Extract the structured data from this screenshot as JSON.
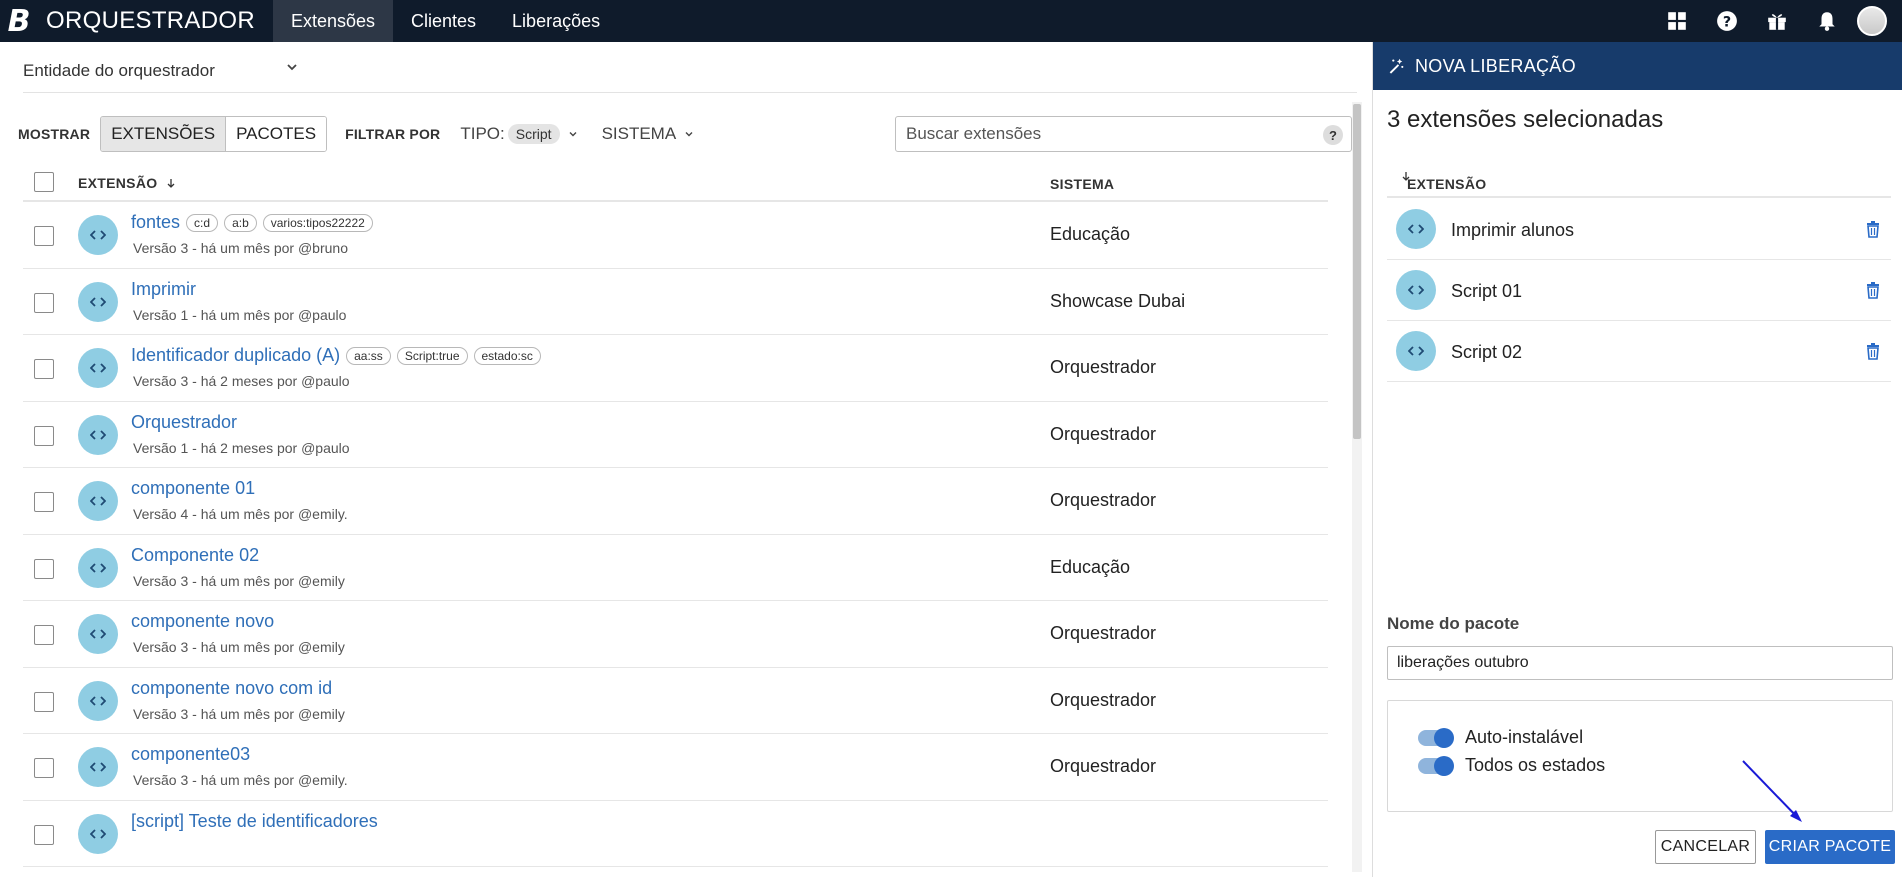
{
  "topbar": {
    "logo": "B",
    "app_title": "ORQUESTRADOR",
    "nav": [
      {
        "label": "Extensões",
        "active": true
      },
      {
        "label": "Clientes",
        "active": false
      },
      {
        "label": "Liberações",
        "active": false
      }
    ],
    "icons": [
      "apps-grid-icon",
      "help-icon",
      "gift-icon",
      "bell-icon",
      "user-avatar"
    ]
  },
  "left": {
    "entity_select": "Entidade do orquestrador",
    "filters": {
      "show_label": "MOSTRAR",
      "toggle": [
        "EXTENSÕES",
        "PACOTES"
      ],
      "toggle_active": "EXTENSÕES",
      "filter_by_label": "FILTRAR POR",
      "tipo_label": "TIPO:",
      "tipo_value": "Script",
      "sistema_label": "SISTEMA",
      "search_placeholder": "Buscar extensões",
      "search_help": "?"
    },
    "table": {
      "col_extension": "EXTENSÃO",
      "col_system": "SISTEMA",
      "rows": [
        {
          "name": "fontes",
          "tags": [
            "c:d",
            "a:b",
            "varios:tipos22222"
          ],
          "sub": "Versão 3 - há um mês por @bruno",
          "system": "Educação"
        },
        {
          "name": "Imprimir",
          "tags": [],
          "sub": "Versão 1 - há um mês por @paulo",
          "system": "Showcase Dubai"
        },
        {
          "name": "Identificador duplicado (A)",
          "tags": [
            "aa:ss",
            "Script:true",
            "estado:sc"
          ],
          "sub": "Versão 3 - há 2 meses por @paulo",
          "system": "Orquestrador"
        },
        {
          "name": "Orquestrador",
          "tags": [],
          "sub": "Versão 1 - há 2 meses por @paulo",
          "system": "Orquestrador"
        },
        {
          "name": "componente 01",
          "tags": [],
          "sub": "Versão 4 - há um mês por @emily.",
          "system": "Orquestrador"
        },
        {
          "name": "Componente 02",
          "tags": [],
          "sub": "Versão 3 - há um mês por @emily",
          "system": "Educação"
        },
        {
          "name": "componente novo",
          "tags": [],
          "sub": "Versão 3 - há um mês por @emily",
          "system": "Orquestrador"
        },
        {
          "name": "componente novo com id",
          "tags": [],
          "sub": "Versão 3 - há um mês por @emily",
          "system": "Orquestrador"
        },
        {
          "name": "componente03",
          "tags": [],
          "sub": "Versão 3 - há um mês por @emily.",
          "system": "Orquestrador"
        },
        {
          "name": "[script] Teste de identificadores",
          "tags": [],
          "sub": "",
          "system": ""
        }
      ]
    }
  },
  "right": {
    "header": "NOVA LIBERAÇÃO",
    "count_text": "3 extensões selecionadas",
    "col_extension": "EXTENSÃO",
    "selected": [
      "Imprimir alunos",
      "Script 01",
      "Script 02"
    ],
    "package_label": "Nome do pacote",
    "package_value": "liberações outubro",
    "options": [
      {
        "label": "Auto-instalável",
        "on": true
      },
      {
        "label": "Todos os estados",
        "on": true
      }
    ],
    "cancel": "CANCELAR",
    "create": "CRIAR PACOTE"
  },
  "colors": {
    "topbar": "#0f1b2b",
    "panel_header": "#173b6b",
    "link": "#2f6fb8",
    "primary": "#2a6bc7",
    "ext_icon_bg": "#8fcde3",
    "annotation_arrow": "#1a1ad6"
  }
}
